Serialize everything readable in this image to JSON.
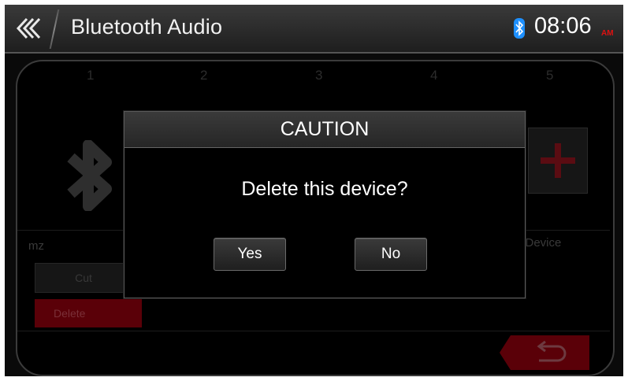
{
  "header": {
    "title": "Bluetooth Audio",
    "time": "08:06",
    "ampm": "AM",
    "back_icon": "double-chevron-left-icon",
    "status_icon": "bluetooth-icon"
  },
  "device_slots": {
    "numbers": [
      "1",
      "2",
      "3",
      "4",
      "5"
    ]
  },
  "background": {
    "device_name": "mz",
    "no_device_label": "o Device",
    "cut_label": "Cut",
    "delete_label": "Delete",
    "add_icon": "plus-icon",
    "return_icon": "return-arrow-icon"
  },
  "dialog": {
    "title": "CAUTION",
    "message": "Delete this device?",
    "yes_label": "Yes",
    "no_label": "No"
  },
  "colors": {
    "accent_red": "#d11a2a",
    "bluetooth_blue": "#1e90ff"
  }
}
